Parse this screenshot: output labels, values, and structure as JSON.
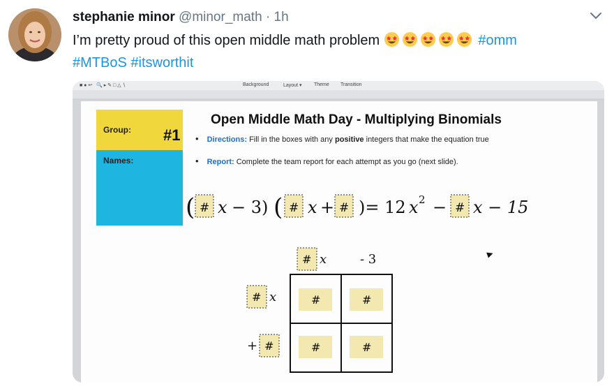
{
  "tweet": {
    "display_name": "stephanie minor",
    "handle": "@minor_math",
    "separator": "·",
    "time": "1h",
    "text": "I’m pretty proud of this open middle math problem",
    "emoji_count": 5,
    "hashtags": [
      "#omm",
      "#MTBoS",
      "#itsworthit"
    ]
  },
  "media": {
    "toolbar": {
      "items": [
        "Background",
        "Layout ▾",
        "Theme",
        "Transition"
      ]
    },
    "slide": {
      "group_label": "Group:",
      "group_number": "#1",
      "names_label": "Names:",
      "title": "Open Middle Math Day - Multiplying Binomials",
      "directions_key": "Directions:",
      "directions_pre": " Fill in the boxes with any ",
      "directions_bold": "positive",
      "directions_post": " integers that make the equation true",
      "report_key": "Report:",
      "report_text": " Complete the team report for each attempt as you go (next slide).",
      "equation": {
        "box": "#",
        "x": "x",
        "minus3": "− 3)",
        "plus": "+",
        "equals": ")= 12",
        "squared": "2",
        "minus": "−",
        "minus15": "x − 15"
      },
      "grid": {
        "box": "#",
        "x": "x",
        "neg3": "- 3",
        "plus": "+"
      }
    }
  },
  "colors": {
    "link": "#1b95e0",
    "group_box": "#f0d73c",
    "names_box": "#1eb6e0",
    "placeholder": "#f3e8b0"
  }
}
